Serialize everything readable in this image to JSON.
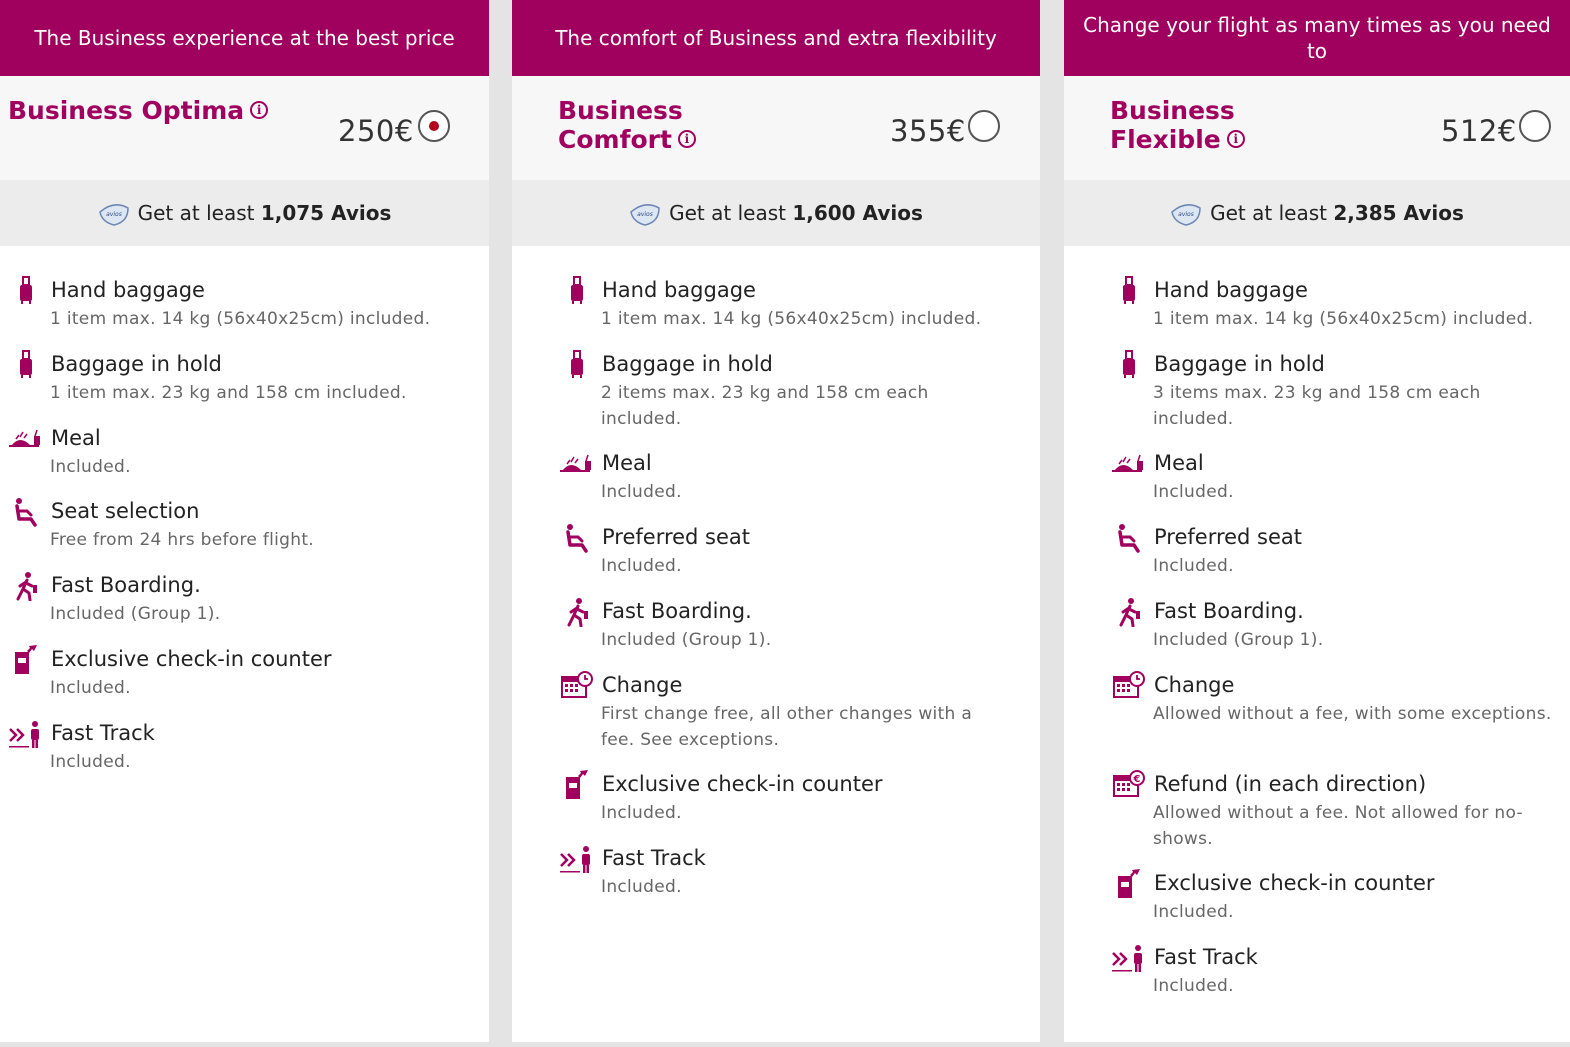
{
  "brand_color": "#a0005e",
  "cards": [
    {
      "banner": "The Business experience at the best price",
      "name": "Business Optima",
      "price": "250€",
      "selected": true,
      "avios_prefix": "Get at least",
      "avios_amount": "1,075 Avios",
      "avios_logo_text": "avios",
      "features": [
        {
          "icon": "suitcase-icon",
          "title": "Hand baggage",
          "desc": "1 item max. 14 kg (56x40x25cm) included."
        },
        {
          "icon": "suitcase-icon",
          "title": "Baggage in hold",
          "desc": "1 item max. 23 kg and 158 cm included."
        },
        {
          "icon": "meal-icon",
          "title": "Meal",
          "desc": "Included."
        },
        {
          "icon": "seat-icon",
          "title": "Seat selection",
          "desc": "Free from 24 hrs before flight."
        },
        {
          "icon": "boarding-icon",
          "title": "Fast Boarding.",
          "desc": "Included (Group 1)."
        },
        {
          "icon": "checkin-icon",
          "title": "Exclusive check-in counter",
          "desc": "Included."
        },
        {
          "icon": "fast-track-icon",
          "title": "Fast Track",
          "desc": "Included."
        }
      ]
    },
    {
      "banner": "The comfort of Business and extra flexibility",
      "name": "Business Comfort",
      "price": "355€",
      "selected": false,
      "avios_prefix": "Get at least",
      "avios_amount": "1,600 Avios",
      "avios_logo_text": "avios",
      "features": [
        {
          "icon": "suitcase-icon",
          "title": "Hand baggage",
          "desc": "1 item max. 14 kg (56x40x25cm) included."
        },
        {
          "icon": "suitcase-icon",
          "title": "Baggage in hold",
          "desc": "2 items max. 23 kg and 158 cm each included."
        },
        {
          "icon": "meal-icon",
          "title": "Meal",
          "desc": "Included."
        },
        {
          "icon": "seat-icon",
          "title": "Preferred seat",
          "desc": "Included."
        },
        {
          "icon": "boarding-icon",
          "title": "Fast Boarding.",
          "desc": "Included (Group 1)."
        },
        {
          "icon": "calendar-change-icon",
          "title": "Change",
          "desc": "First change free, all other changes with a fee. See exceptions."
        },
        {
          "icon": "checkin-icon",
          "title": "Exclusive check-in counter",
          "desc": "Included."
        },
        {
          "icon": "fast-track-icon",
          "title": "Fast Track",
          "desc": "Included."
        }
      ]
    },
    {
      "banner": "Change your flight as many times as you need to",
      "name": "Business Flexible",
      "price": "512€",
      "selected": false,
      "avios_prefix": "Get at least",
      "avios_amount": "2,385 Avios",
      "avios_logo_text": "avios",
      "features": [
        {
          "icon": "suitcase-icon",
          "title": "Hand baggage",
          "desc": "1 item max. 14 kg (56x40x25cm) included."
        },
        {
          "icon": "suitcase-icon",
          "title": "Baggage in hold",
          "desc": "3 items max. 23 kg and 158 cm each included."
        },
        {
          "icon": "meal-icon",
          "title": "Meal",
          "desc": "Included."
        },
        {
          "icon": "seat-icon",
          "title": "Preferred seat",
          "desc": "Included."
        },
        {
          "icon": "boarding-icon",
          "title": "Fast Boarding.",
          "desc": "Included (Group 1)."
        },
        {
          "icon": "calendar-change-icon",
          "title": "Change",
          "desc": "Allowed without a fee, with some exceptions."
        },
        {
          "icon": "calendar-refund-icon",
          "title": "Refund (in each direction)",
          "desc": "Allowed without a fee. Not allowed for no-shows."
        },
        {
          "icon": "checkin-icon",
          "title": "Exclusive check-in counter",
          "desc": "Included."
        },
        {
          "icon": "fast-track-icon",
          "title": "Fast Track",
          "desc": "Included."
        }
      ]
    }
  ]
}
